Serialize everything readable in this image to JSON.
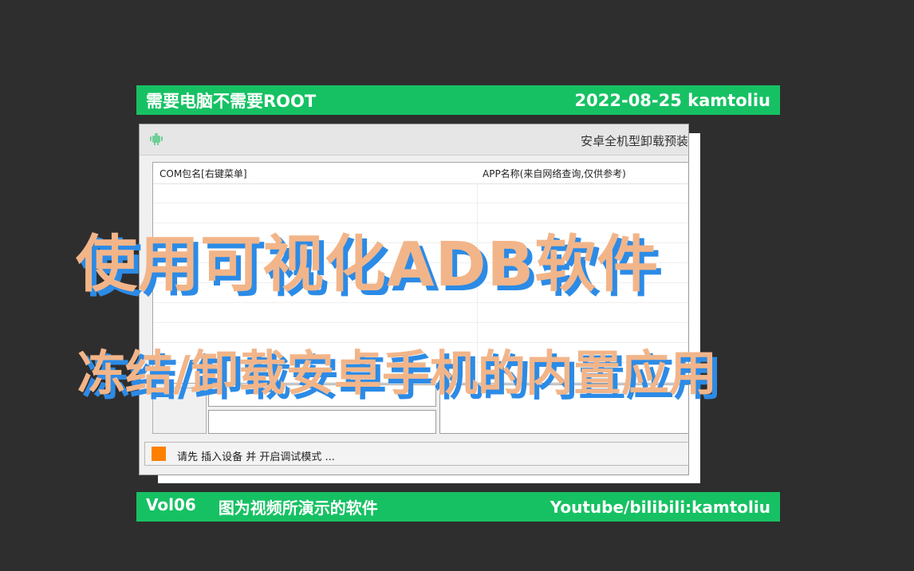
{
  "top_bar": {
    "left_text": "需要电脑不需要ROOT",
    "right_text": "2022-08-25 kamtoliu"
  },
  "bottom_bar": {
    "vol": "Vol06",
    "caption": "图为视频所演示的软件",
    "right_text": "Youtube/bilibili:kamtoliu"
  },
  "window": {
    "icon": "android-icon",
    "title": "安卓全机型卸载预装",
    "list": {
      "col1_header": "COM包名[右键菜单]",
      "col2_header": "APP名称(来自网络查询,仅供参考)"
    },
    "status": {
      "led_color": "#ff8000",
      "text": "请先 插入设备 并 开启调试模式 ..."
    }
  },
  "headline": {
    "line1": "使用可视化ADB软件",
    "line2": "冻结/卸载安卓手机的内置应用"
  },
  "colors": {
    "bar_green": "#16c163",
    "headline_fill": "#f2b589",
    "headline_shadow": "#2c8be6",
    "background": "#2e2e2e"
  }
}
